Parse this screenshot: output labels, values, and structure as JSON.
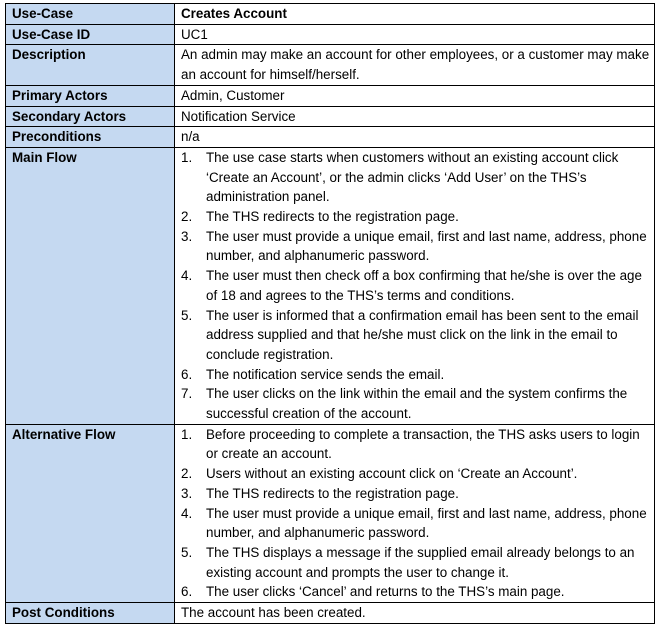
{
  "use_case": {
    "rows": {
      "use_case": {
        "label": "Use-Case",
        "value": "Creates Account"
      },
      "id": {
        "label": "Use-Case ID",
        "value": "UC1"
      },
      "description": {
        "label": "Description",
        "value": "An admin may make an account for other employees, or a customer may make an account for himself/herself."
      },
      "primary_actors": {
        "label": "Primary Actors",
        "value": "Admin, Customer"
      },
      "secondary_actors": {
        "label": "Secondary Actors",
        "value": "Notification Service"
      },
      "preconditions": {
        "label": "Preconditions",
        "value": "n/a"
      },
      "main_flow": {
        "label": "Main Flow",
        "steps": [
          {
            "num": "1.",
            "text": "The use case starts when customers without an existing account click ‘Create an Account’, or the admin clicks ‘Add User’ on the THS’s administration panel."
          },
          {
            "num": "2.",
            "text": "The THS redirects to the registration page."
          },
          {
            "num": "3.",
            "text": "The user must provide a unique email, first and last name, address, phone number, and alphanumeric password."
          },
          {
            "num": "4.",
            "text": "The user must then check off a box confirming that he/she is over the age of 18 and agrees to the THS’s terms and conditions."
          },
          {
            "num": "5.",
            "text": "The user is informed that a confirmation email has been sent to the email address supplied and that he/she must click on the link in the email to conclude registration."
          },
          {
            "num": "6.",
            "text": "The notification service sends the email."
          },
          {
            "num": "7.",
            "text": "The user clicks on the link within the email and the system confirms the successful creation of the account."
          }
        ]
      },
      "alternative_flow": {
        "label": "Alternative Flow",
        "steps": [
          {
            "num": "1.",
            "text": "Before proceeding to complete a transaction, the THS asks users to login or create an account."
          },
          {
            "num": "2.",
            "text": "Users without an existing account click on ‘Create an Account’."
          },
          {
            "num": "3.",
            "text": "The THS redirects to the registration page."
          },
          {
            "num": "4.",
            "text": "The user must provide a unique email, first and last name, address, phone number, and alphanumeric password."
          },
          {
            "num": "5.",
            "text": "The THS displays a message if the supplied email already belongs to an existing account and prompts the user to change it."
          },
          {
            "num": "6.",
            "text": "The user clicks ‘Cancel’ and returns to the THS’s main page."
          }
        ]
      },
      "post_conditions": {
        "label": "Post Conditions",
        "value": "The account has been created."
      }
    },
    "colors": {
      "label_background": "#c5d9f1",
      "border": "#000000"
    }
  }
}
